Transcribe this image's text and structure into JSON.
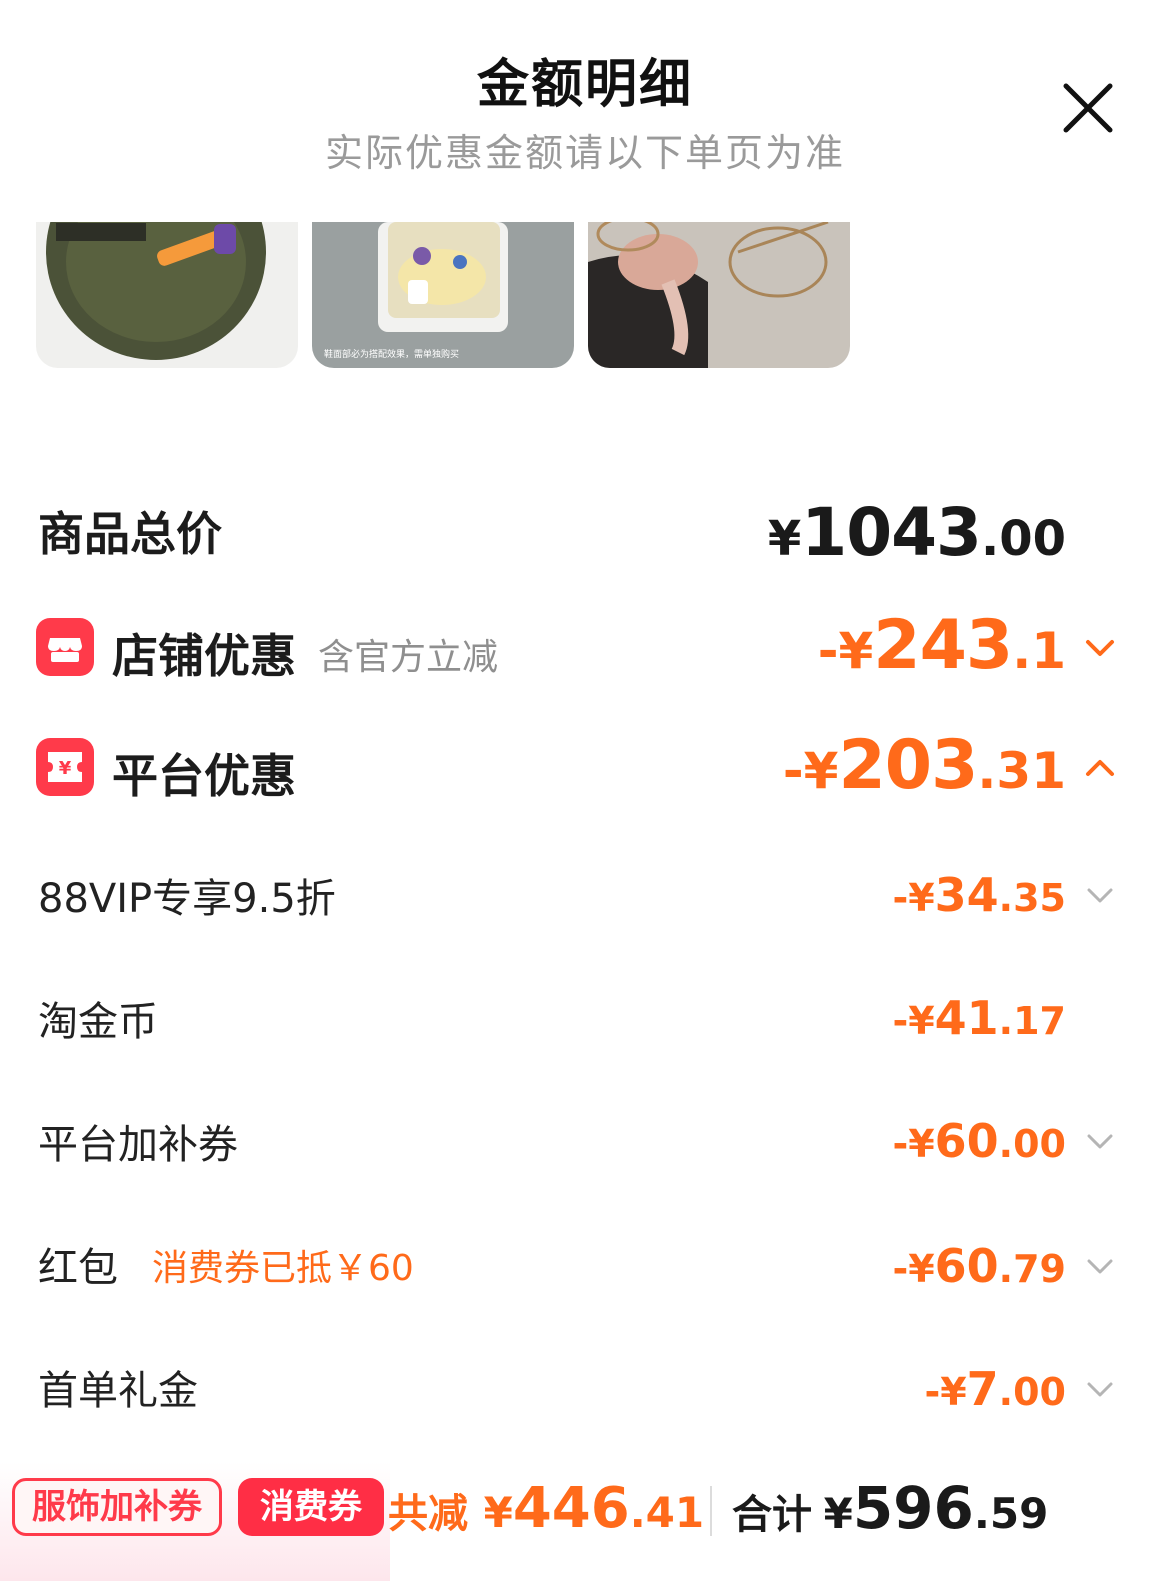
{
  "header": {
    "title": "金额明细",
    "subtitle": "实际优惠金额请以下单页为准",
    "close_icon": "close-icon"
  },
  "thumbnails": [
    {
      "name": "product-bag",
      "caption": ""
    },
    {
      "name": "product-shoe",
      "caption": "鞋面部必为搭配效果，需单独购买"
    },
    {
      "name": "product-glasses",
      "caption": ""
    }
  ],
  "summary": {
    "total_label": "商品总价",
    "total_currency": "¥",
    "total_int": "1043",
    "total_dec": ".00"
  },
  "store_discount": {
    "icon": "shop-icon",
    "label": "店铺优惠",
    "note": "含官方立减",
    "sign": "-¥",
    "int": "243",
    "dec": ".1",
    "chevron": "chevron-down-icon"
  },
  "platform_discount": {
    "icon": "yen-coupon-icon",
    "label": "平台优惠",
    "sign": "-¥",
    "int": "203",
    "dec": ".31",
    "chevron": "chevron-up-icon"
  },
  "platform_items": [
    {
      "label": "88VIP专享9.5折",
      "note": "",
      "sign": "-¥",
      "int": "34",
      "dec": ".35",
      "has_chevron": true
    },
    {
      "label": "淘金币",
      "note": "",
      "sign": "-¥",
      "int": "41",
      "dec": ".17",
      "has_chevron": false
    },
    {
      "label": "平台加补券",
      "note": "",
      "sign": "-¥",
      "int": "60",
      "dec": ".00",
      "has_chevron": true
    },
    {
      "label": "红包",
      "note": "消费券已抵￥60",
      "sign": "-¥",
      "int": "60",
      "dec": ".79",
      "has_chevron": true
    },
    {
      "label": "首单礼金",
      "note": "",
      "sign": "-¥",
      "int": "7",
      "dec": ".00",
      "has_chevron": true
    }
  ],
  "bottom_bar": {
    "tag_outline": "服饰加补券",
    "tag_solid": "消费券",
    "saved_label": "共减",
    "saved_currency": "¥",
    "saved_int": "446",
    "saved_dec": ".41",
    "total_label": "合计",
    "total_currency": "¥",
    "total_int": "596",
    "total_dec": ".59"
  },
  "colors": {
    "accent_orange": "#ff6a1a",
    "badge_red": "#ff3a4a",
    "text_dark": "#1a1a1a",
    "text_gray": "#8f8f8f"
  }
}
